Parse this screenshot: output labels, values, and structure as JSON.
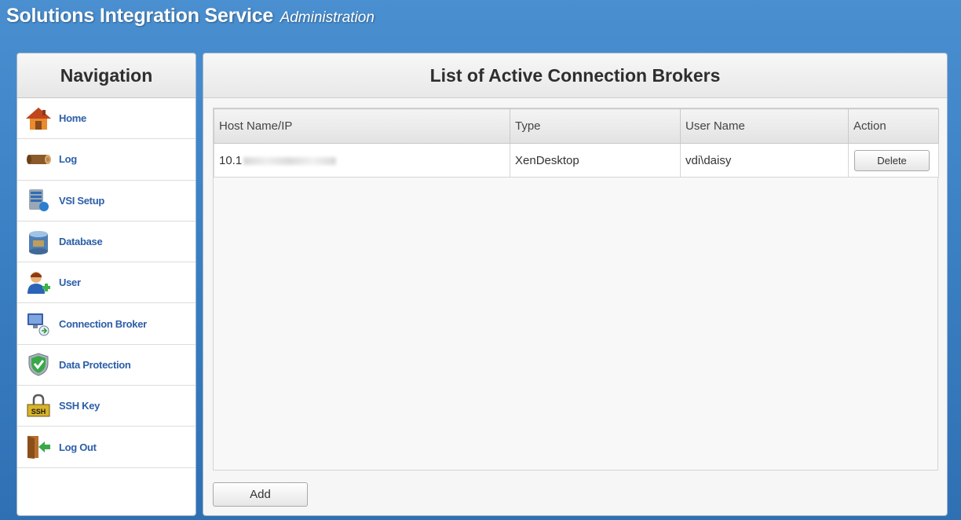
{
  "header": {
    "title": "Solutions Integration Service",
    "subtitle": "Administration"
  },
  "sidebar": {
    "heading": "Navigation",
    "items": [
      {
        "label": "Home",
        "icon": "home-icon"
      },
      {
        "label": "Log",
        "icon": "log-icon"
      },
      {
        "label": "VSI Setup",
        "icon": "vsi-setup-icon"
      },
      {
        "label": "Database",
        "icon": "database-icon"
      },
      {
        "label": "User",
        "icon": "user-icon"
      },
      {
        "label": "Connection Broker",
        "icon": "connection-broker-icon"
      },
      {
        "label": "Data Protection",
        "icon": "shield-check-icon"
      },
      {
        "label": "SSH Key",
        "icon": "ssh-lock-icon"
      },
      {
        "label": "Log Out",
        "icon": "logout-door-icon"
      }
    ]
  },
  "main": {
    "heading": "List of Active Connection Brokers",
    "table": {
      "columns": [
        "Host Name/IP",
        "Type",
        "User Name",
        "Action"
      ],
      "rows": [
        {
          "host": "10.1",
          "type": "XenDesktop",
          "user": "vdi\\daisy",
          "action": "Delete"
        }
      ]
    },
    "add_label": "Add"
  },
  "colors": {
    "header_blue": "#3c82c5",
    "nav_link": "#2b5ea8"
  }
}
